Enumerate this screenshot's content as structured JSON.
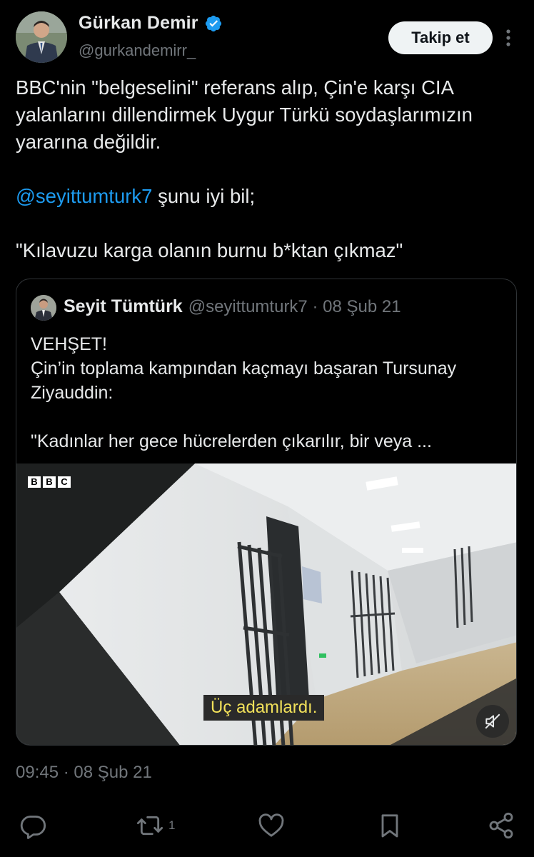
{
  "author": {
    "display_name": "Gürkan Demir",
    "handle": "@gurkandemirr_",
    "verified": true
  },
  "follow_button": {
    "label": "Takip et"
  },
  "tweet": {
    "line1": "BBC'nin \"belgeselini\" referans alıp, Çin'e karşı CIA yalanlarını dillendirmek Uygur Türkü soydaşlarımızın yararına değildir.",
    "mention": "@seyittumturk7",
    "line2_rest": " şunu iyi bil;",
    "line3": "\"Kılavuzu karga olanın burnu b*ktan çıkmaz\"",
    "time": "09:45",
    "date": "08 Şub 21",
    "separator": "·"
  },
  "quoted_tweet": {
    "display_name": "Seyit Tümtürk",
    "meta": "@seyittumturk7 · 08 Şub 21",
    "line1": "VEHŞET!",
    "line2": "Çin’in toplama kampından kaçmayı başaran Tursunay Ziyauddin:",
    "line3": "\"Kadınlar her gece hücrelerden çıkarılır, bir veya ...",
    "media": {
      "logo_letters": [
        "B",
        "B",
        "C"
      ],
      "subtitle": "Üç adamlardı.",
      "muted": true
    }
  },
  "actions": {
    "retweet_count": "1"
  },
  "colors": {
    "background": "#000000",
    "text": "#e7e9ea",
    "secondary": "#71767b",
    "link": "#1d9bf0",
    "border": "#2f3336"
  }
}
